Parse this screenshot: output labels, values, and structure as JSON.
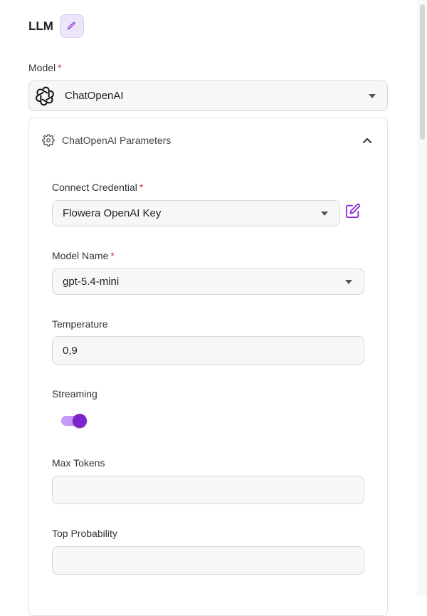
{
  "header": {
    "title": "LLM",
    "edit_icon": "pencil-icon"
  },
  "model": {
    "label": "Model",
    "required_mark": "*",
    "value": "ChatOpenAI",
    "logo_icon": "openai-logo-icon"
  },
  "params": {
    "title": "ChatOpenAI Parameters",
    "icon": "gear-icon",
    "expanded": true,
    "fields": {
      "credential": {
        "label": "Connect Credential",
        "required_mark": "*",
        "value": "Flowera OpenAI Key",
        "edit_icon": "edit-icon"
      },
      "model_name": {
        "label": "Model Name",
        "required_mark": "*",
        "value": "gpt-5.4-mini"
      },
      "temperature": {
        "label": "Temperature",
        "value": "0,9"
      },
      "streaming": {
        "label": "Streaming",
        "enabled": true
      },
      "max_tokens": {
        "label": "Max Tokens",
        "value": ""
      },
      "top_probability": {
        "label": "Top Probability",
        "value": ""
      }
    }
  },
  "colors": {
    "accent": "#7e22ce",
    "accent_light": "#ede6fb",
    "required": "#d32f2f",
    "input_bg": "#f7f7f7",
    "border": "#d9d9d9"
  }
}
